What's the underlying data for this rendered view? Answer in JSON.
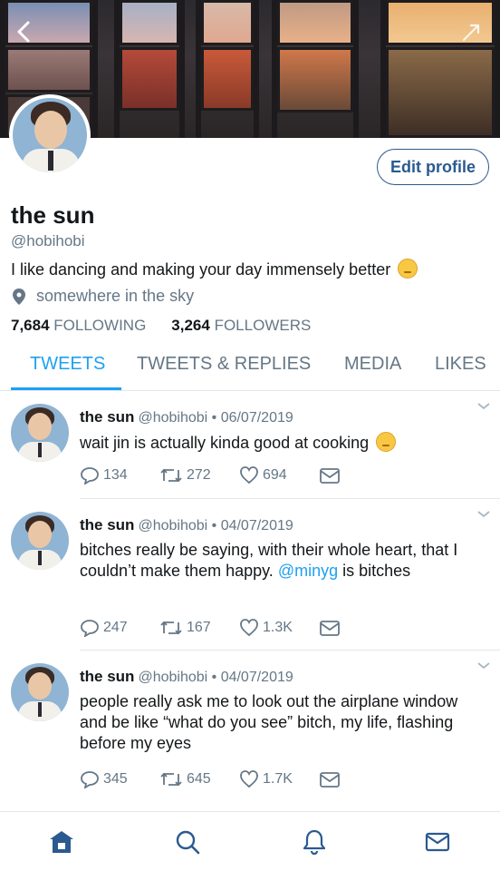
{
  "profile": {
    "name": "the sun",
    "handle": "@hobihobi",
    "bio": "I like dancing and making your day immensely better",
    "location": "somewhere in the sky",
    "following_count": "7,684",
    "following_label": "FOLLOWING",
    "followers_count": "3,264",
    "followers_label": "FOLLOWERS",
    "edit_label": "Edit profile"
  },
  "tabs": [
    {
      "label": "TWEETS",
      "active": true
    },
    {
      "label": "TWEETS & REPLIES",
      "active": false
    },
    {
      "label": "MEDIA",
      "active": false
    },
    {
      "label": "LIKES",
      "active": false
    }
  ],
  "tweets": [
    {
      "name": "the sun",
      "meta": "@hobihobi • 06/07/2019",
      "text": "wait jin is actually kinda good at cooking",
      "replies": "134",
      "retweets": "272",
      "likes": "694"
    },
    {
      "name": "the sun",
      "meta": "@hobihobi • 04/07/2019",
      "text_before": "bitches really be saying, with their whole heart, that I couldn’t make them happy.",
      "mention": "@minyg",
      "text_after": "is bitches",
      "replies": "247",
      "retweets": "167",
      "likes": "1.3K"
    },
    {
      "name": "the sun",
      "meta": "@hobihobi • 04/07/2019",
      "text": "people really ask me to look out the airplane window and be like “what do you see” bitch, my life, flashing before my eyes",
      "replies": "345",
      "retweets": "645",
      "likes": "1.7K"
    }
  ],
  "nav": [
    "home-icon",
    "search-icon",
    "notifications-icon",
    "messages-icon"
  ],
  "colors": {
    "accent": "#1da1f2",
    "nav_active": "#2a5a8f",
    "muted": "#657786"
  }
}
